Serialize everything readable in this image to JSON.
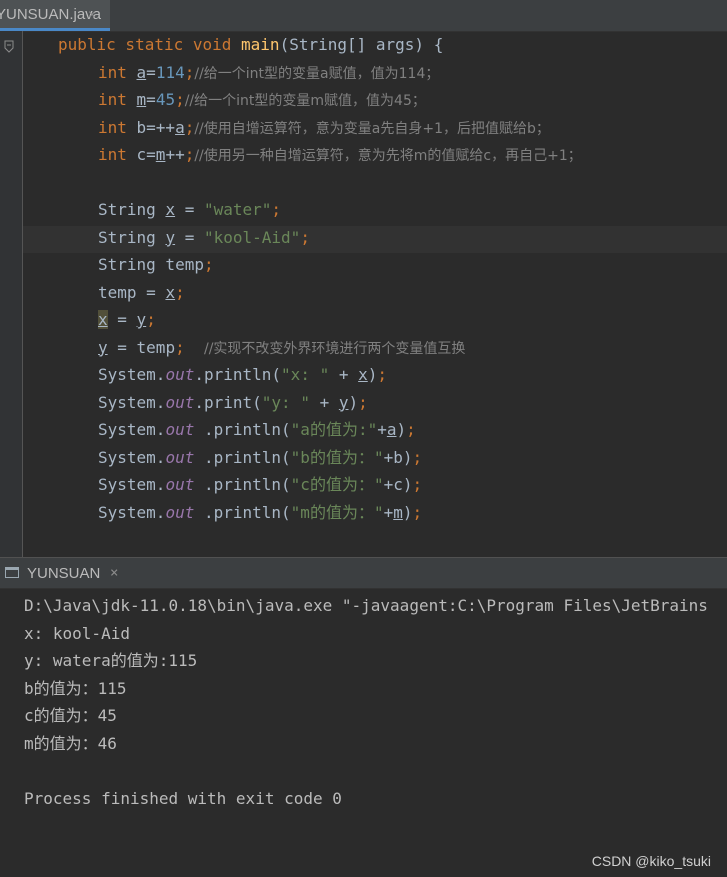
{
  "editor": {
    "tab_label": "YUNSUAN.java",
    "tab_close": "×",
    "lines": [
      {
        "parts": [
          [
            "kw",
            "public static void "
          ],
          [
            "fn",
            "main"
          ],
          [
            "p",
            "(String[] args) {"
          ]
        ]
      },
      {
        "parts": [
          [
            "kw",
            "int "
          ],
          [
            "u",
            "a"
          ],
          [
            "p",
            "="
          ],
          [
            "num",
            "114"
          ],
          [
            "kw",
            ";"
          ],
          [
            "cmt",
            "//给一个int型的变量a赋值，值为114；"
          ]
        ]
      },
      {
        "parts": [
          [
            "kw",
            "int "
          ],
          [
            "u",
            "m"
          ],
          [
            "p",
            "="
          ],
          [
            "num",
            "45"
          ],
          [
            "kw",
            ";"
          ],
          [
            "cmt",
            "//给一个int型的变量m赋值，值为45；"
          ]
        ]
      },
      {
        "parts": [
          [
            "kw",
            "int "
          ],
          [
            "p",
            "b=++"
          ],
          [
            "u",
            "a"
          ],
          [
            "kw",
            ";"
          ],
          [
            "cmt",
            "//使用自增运算符，意为变量a先自身+1，后把值赋给b；"
          ]
        ]
      },
      {
        "parts": [
          [
            "kw",
            "int "
          ],
          [
            "p",
            "c="
          ],
          [
            "u",
            "m"
          ],
          [
            "p",
            "++"
          ],
          [
            "kw",
            ";"
          ],
          [
            "cmt",
            "//使用另一种自增运算符，意为先将m的值赋给c，再自己+1；"
          ]
        ]
      },
      {
        "parts": []
      },
      {
        "parts": [
          [
            "p",
            "String "
          ],
          [
            "u",
            "x"
          ],
          [
            "p",
            " = "
          ],
          [
            "str",
            "\"water\""
          ],
          [
            "kw",
            ";"
          ]
        ]
      },
      {
        "parts": [
          [
            "p",
            "String "
          ],
          [
            "u",
            "y"
          ],
          [
            "p",
            " = "
          ],
          [
            "str",
            "\"kool-Aid\""
          ],
          [
            "kw",
            ";"
          ]
        ]
      },
      {
        "parts": [
          [
            "p",
            "String temp"
          ],
          [
            "kw",
            ";"
          ]
        ]
      },
      {
        "parts": [
          [
            "p",
            "temp = "
          ],
          [
            "u",
            "x"
          ],
          [
            "kw",
            ";"
          ]
        ]
      },
      {
        "parts": [
          [
            "uh",
            "x"
          ],
          [
            "p",
            " = "
          ],
          [
            "u",
            "y"
          ],
          [
            "kw",
            ";"
          ]
        ]
      },
      {
        "parts": [
          [
            "u",
            "y"
          ],
          [
            "p",
            " = temp"
          ],
          [
            "kw",
            ";"
          ],
          [
            "p",
            "  "
          ],
          [
            "cmt",
            "//实现不改变外界环境进行两个变量值互换"
          ]
        ]
      },
      {
        "parts": [
          [
            "p",
            "System."
          ],
          [
            "fld",
            "out"
          ],
          [
            "p",
            ".println("
          ],
          [
            "str",
            "\"x: \""
          ],
          [
            "p",
            " + "
          ],
          [
            "u",
            "x"
          ],
          [
            "p",
            ")"
          ],
          [
            "kw",
            ";"
          ]
        ]
      },
      {
        "parts": [
          [
            "p",
            "System."
          ],
          [
            "fld",
            "out"
          ],
          [
            "p",
            ".print("
          ],
          [
            "str",
            "\"y: \""
          ],
          [
            "p",
            " + "
          ],
          [
            "u",
            "y"
          ],
          [
            "p",
            ")"
          ],
          [
            "kw",
            ";"
          ]
        ]
      },
      {
        "parts": [
          [
            "p",
            "System."
          ],
          [
            "fld",
            "out"
          ],
          [
            "p",
            " .println("
          ],
          [
            "str",
            "\"a的值为:\""
          ],
          [
            "p",
            "+"
          ],
          [
            "u",
            "a"
          ],
          [
            "p",
            ")"
          ],
          [
            "kw",
            ";"
          ]
        ]
      },
      {
        "parts": [
          [
            "p",
            "System."
          ],
          [
            "fld",
            "out"
          ],
          [
            "p",
            " .println("
          ],
          [
            "str",
            "\"b的值为：\""
          ],
          [
            "p",
            "+b)"
          ],
          [
            "kw",
            ";"
          ]
        ]
      },
      {
        "parts": [
          [
            "p",
            "System."
          ],
          [
            "fld",
            "out"
          ],
          [
            "p",
            " .println("
          ],
          [
            "str",
            "\"c的值为：\""
          ],
          [
            "p",
            "+c)"
          ],
          [
            "kw",
            ";"
          ]
        ]
      },
      {
        "parts": [
          [
            "p",
            "System."
          ],
          [
            "fld",
            "out"
          ],
          [
            "p",
            " .println("
          ],
          [
            "str",
            "\"m的值为：\""
          ],
          [
            "p",
            "+"
          ],
          [
            "u",
            "m"
          ],
          [
            "p",
            ")"
          ],
          [
            "kw",
            ";"
          ]
        ]
      }
    ]
  },
  "run_panel": {
    "tab_label": "YUNSUAN",
    "tab_close": "×",
    "output": [
      "D:\\Java\\jdk-11.0.18\\bin\\java.exe \"-javaagent:C:\\Program Files\\JetBrains",
      "x: kool-Aid",
      "y: watera的值为:115",
      "b的值为：115",
      "c的值为：45",
      "m的值为：46",
      "",
      "Process finished with exit code 0"
    ]
  },
  "watermark": "CSDN @kiko_tsuki"
}
